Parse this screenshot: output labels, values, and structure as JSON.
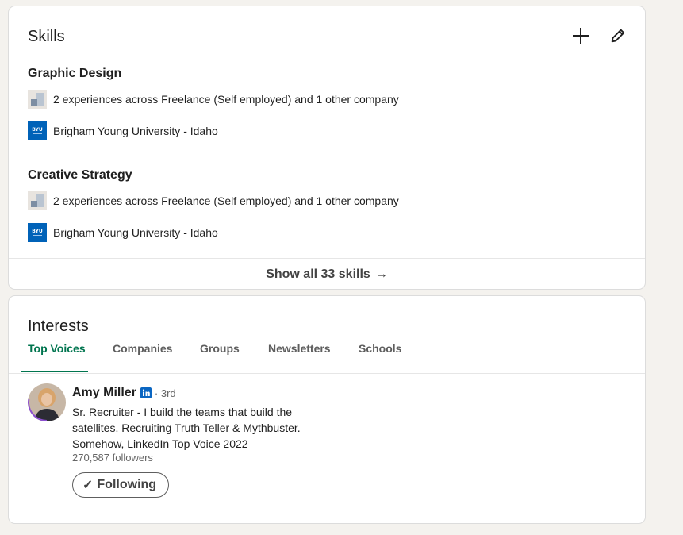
{
  "skills": {
    "title": "Skills",
    "add_icon": "plus-icon",
    "edit_icon": "pencil-icon",
    "items": [
      {
        "name": "Graphic Design",
        "experience_text": "2 experiences across Freelance (Self employed) and 1 other company",
        "education_text": "Brigham Young University - Idaho"
      },
      {
        "name": "Creative Strategy",
        "experience_text": "2 experiences across Freelance (Self employed) and 1 other company",
        "education_text": "Brigham Young University - Idaho"
      }
    ],
    "show_all_label": "Show all 33 skills",
    "show_all_arrow": "→"
  },
  "interests": {
    "title": "Interests",
    "tabs": [
      {
        "label": "Top Voices",
        "active": true
      },
      {
        "label": "Companies"
      },
      {
        "label": "Groups"
      },
      {
        "label": "Newsletters"
      },
      {
        "label": "Schools"
      }
    ],
    "person": {
      "name": "Amy Miller",
      "badge_icon": "linkedin-icon",
      "degree": "· 3rd",
      "headline": "Sr. Recruiter - I build the teams that build the satellites. Recruiting Truth Teller & Mythbuster. Somehow, LinkedIn Top Voice 2022",
      "followers": "270,587 followers",
      "follow_check": "✓",
      "follow_label": "Following"
    }
  },
  "colors": {
    "accent_green": "#01754f",
    "byu_blue": "#0062b8",
    "linkedin_blue": "#0a66c2"
  }
}
